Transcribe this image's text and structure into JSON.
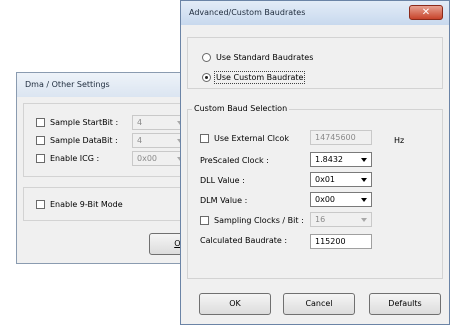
{
  "dma_window": {
    "title": "Dma / Other Settings",
    "sample_startbit": {
      "label": "Sample StartBit :",
      "value": "4"
    },
    "sample_databit": {
      "label": "Sample DataBit :",
      "value": "4"
    },
    "enable_icg": {
      "label": "Enable ICG :",
      "value": "0x00"
    },
    "enable_9bit": {
      "label": "Enable 9-Bit Mode"
    },
    "ok_label": "OK"
  },
  "baud_window": {
    "title": "Advanced/Custom Baudrates",
    "close_glyph": "✕",
    "radio_standard": "Use Standard Baudrates",
    "radio_custom": "Use Custom Baudrate",
    "group_title": "Custom Baud Selection",
    "external_clock": {
      "label": "Use External Clcok",
      "value": "14745600",
      "unit": "Hz"
    },
    "prescaled_clock": {
      "label": "PreScaled Clock :",
      "value": "1.8432"
    },
    "dll_value": {
      "label": "DLL Value :",
      "value": "0x01"
    },
    "dlm_value": {
      "label": "DLM Value :",
      "value": "0x00"
    },
    "sampling_clocks": {
      "label": "Sampling Clocks / Bit :",
      "value": "16"
    },
    "calculated_baudrate": {
      "label": "Calculated Baudrate :",
      "value": "115200"
    },
    "buttons": {
      "ok": "OK",
      "cancel": "Cancel",
      "defaults": "Defaults"
    }
  }
}
